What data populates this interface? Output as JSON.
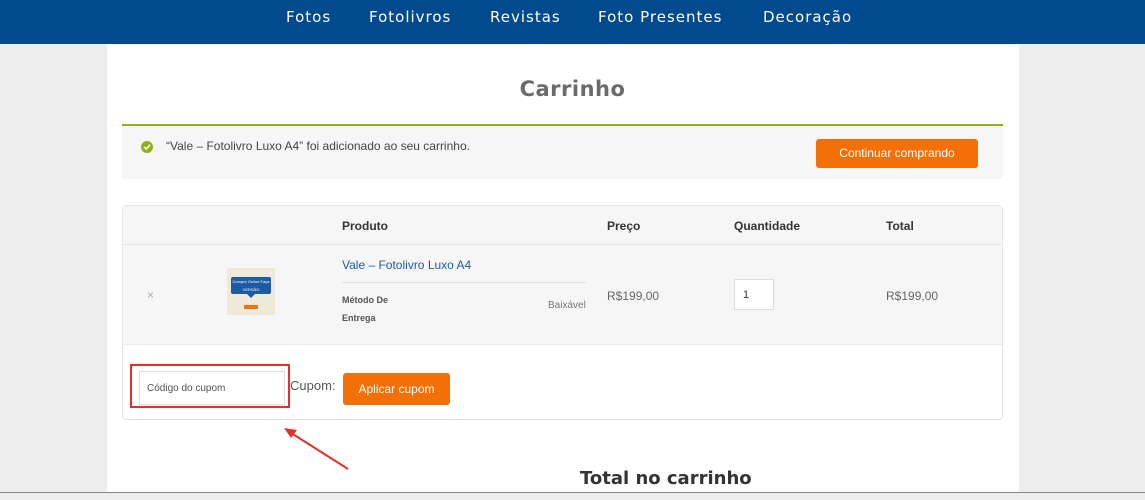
{
  "nav": {
    "items": [
      {
        "label": "Fotos"
      },
      {
        "label": "Fotolivros"
      },
      {
        "label": "Revistas"
      },
      {
        "label": "Foto Presentes"
      },
      {
        "label": "Decoração"
      }
    ]
  },
  "page": {
    "title": "Carrinho"
  },
  "notice": {
    "message": "“Vale – Fotolivro Luxo A4” foi adicionado ao seu carrinho.",
    "button_label": "Continuar comprando",
    "icon": "check-circle-icon",
    "color": "#8fae1b"
  },
  "cart": {
    "columns": [
      "Produto",
      "Preço",
      "Quantidade",
      "Total"
    ],
    "items": [
      {
        "remove_label": "×",
        "thumbnail_text": "Compre Online Faça VERSÃO",
        "name": "Vale – Fotolivro Luxo A4",
        "meta_label": "Método De Entrega",
        "meta_value": "Baixável",
        "price": "R$199,00",
        "quantity": "1",
        "total": "R$199,00"
      }
    ],
    "coupon": {
      "placeholder": "Código do cupom",
      "label": "Cupom:",
      "button_label": "Aplicar cupom"
    }
  },
  "totals": {
    "title": "Total no carrinho"
  },
  "colors": {
    "nav_bg": "#004a8d",
    "accent": "#f36f08",
    "link": "#1c5aa3",
    "annotation": "#e0312f"
  }
}
